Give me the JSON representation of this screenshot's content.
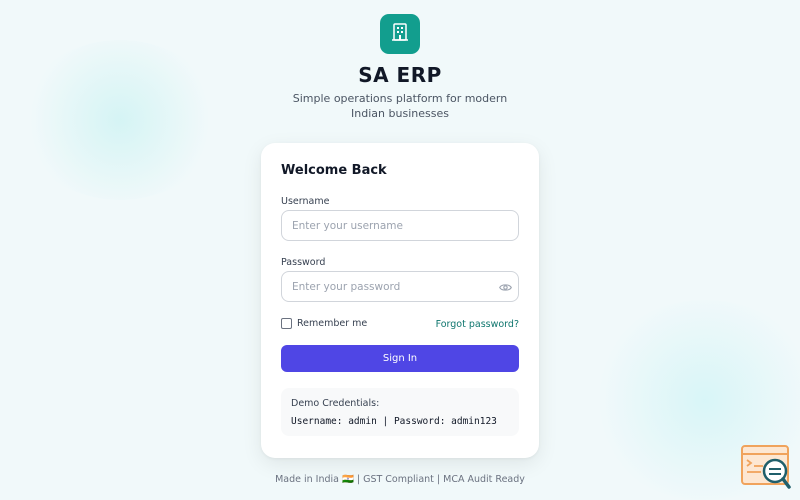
{
  "app": {
    "title": "SA ERP",
    "subtitle": "Simple operations platform for modern Indian businesses",
    "logo_icon": "building-icon",
    "brand_color": "#129e8e"
  },
  "login": {
    "heading": "Welcome Back",
    "username_label": "Username",
    "username_placeholder": "Enter your username",
    "username_value": "",
    "password_label": "Password",
    "password_placeholder": "Enter your password",
    "password_value": "",
    "password_toggle_icon": "eye-icon",
    "remember_label": "Remember me",
    "remember_checked": false,
    "forgot_label": "Forgot password?",
    "signin_label": "Sign In",
    "accent_color": "#4f46e5"
  },
  "demo": {
    "title": "Demo Credentials:",
    "credentials": "Username: admin | Password: admin123"
  },
  "footer": {
    "text": "Made in India 🇮🇳 | GST Compliant | MCA Audit Ready"
  },
  "widget": {
    "icon": "code-search-icon"
  }
}
